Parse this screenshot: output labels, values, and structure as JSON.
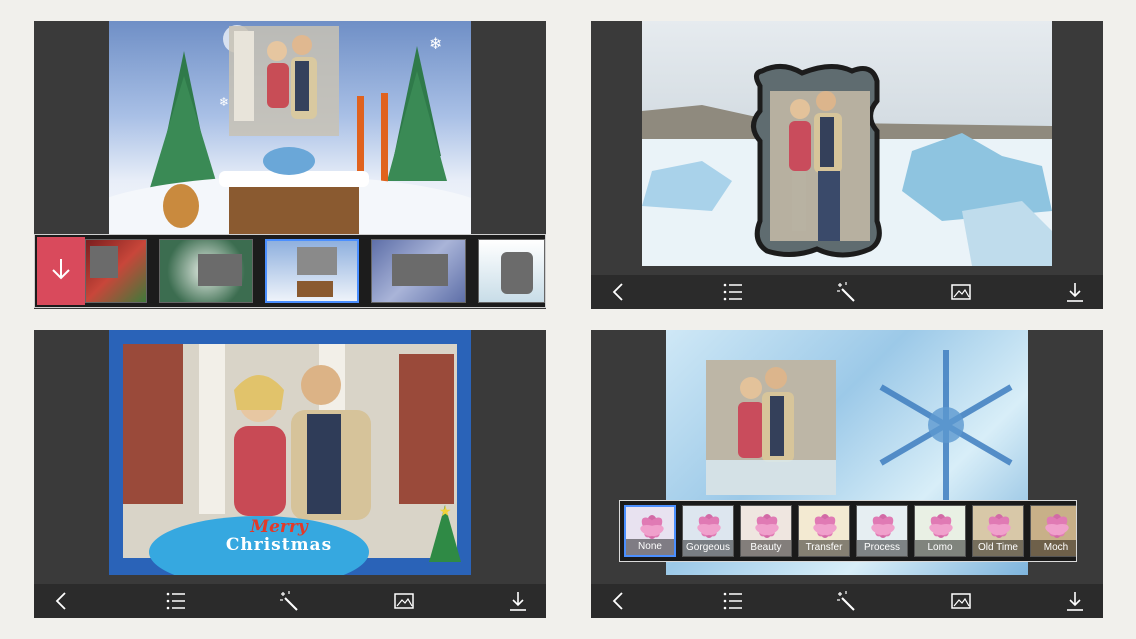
{
  "panels": {
    "top_left": {
      "frames": [
        {
          "name": "christmas-gifts-frame"
        },
        {
          "name": "evergreen-frame"
        },
        {
          "name": "ski-snow-frame",
          "selected": true
        },
        {
          "name": "frost-frame"
        },
        {
          "name": "cut-shape-frame"
        }
      ]
    },
    "bottom_left": {
      "greeting_line1": "Merry",
      "greeting_line2": "Christmas"
    },
    "bottom_right": {
      "filters": [
        {
          "label": "None",
          "selected": true
        },
        {
          "label": "Gorgeous"
        },
        {
          "label": "Beauty"
        },
        {
          "label": "Transfer"
        },
        {
          "label": "Process"
        },
        {
          "label": "Lomo"
        },
        {
          "label": "Old Time"
        },
        {
          "label": "Moch"
        }
      ]
    }
  },
  "toolbar_icons": [
    "back-chevron-icon",
    "list-icon",
    "magic-wand-icon",
    "image-icon",
    "download-icon"
  ],
  "colors": {
    "accent_download": "#d94a5c",
    "selection": "#4b8fff",
    "panel_bg": "#3a3a3a",
    "toolbar_bg": "#2b2b2b"
  }
}
